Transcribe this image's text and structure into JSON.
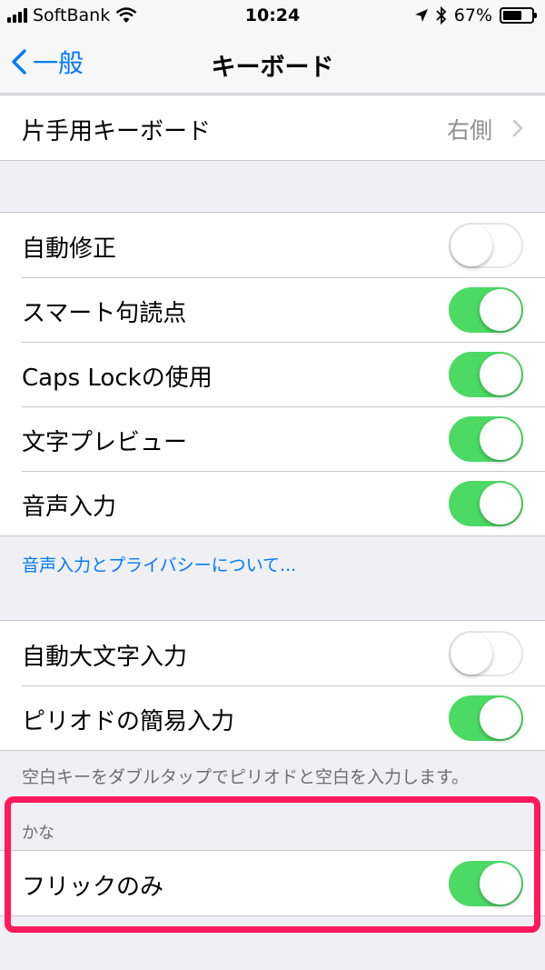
{
  "status_bar": {
    "carrier": "SoftBank",
    "time": "10:24",
    "battery": "67%",
    "battery_level": 0.67,
    "icons": [
      "signal-bars-icon",
      "wifi-icon",
      "location-arrow-icon",
      "bluetooth-icon",
      "battery-icon"
    ]
  },
  "nav": {
    "back_label": "一般",
    "title": "キーボード"
  },
  "one_hand": {
    "label": "片手用キーボード",
    "value": "右側"
  },
  "group1": [
    {
      "label": "自動修正",
      "on": false
    },
    {
      "label": "スマート句読点",
      "on": true
    },
    {
      "label": "Caps Lockの使用",
      "on": true
    },
    {
      "label": "文字プレビュー",
      "on": true
    },
    {
      "label": "音声入力",
      "on": true
    }
  ],
  "privacy_link": "音声入力とプライバシーについて...",
  "group2": [
    {
      "label": "自動大文字入力",
      "on": false
    },
    {
      "label": "ピリオドの簡易入力",
      "on": true
    }
  ],
  "period_footer": "空白キーをダブルタップでピリオドと空白を入力します。",
  "kana": {
    "header": "かな",
    "flick_label": "フリックのみ",
    "flick_on": true
  },
  "colors": {
    "accent": "#007aff",
    "toggle_on": "#4cd964",
    "highlight": "#ff1a5e"
  }
}
